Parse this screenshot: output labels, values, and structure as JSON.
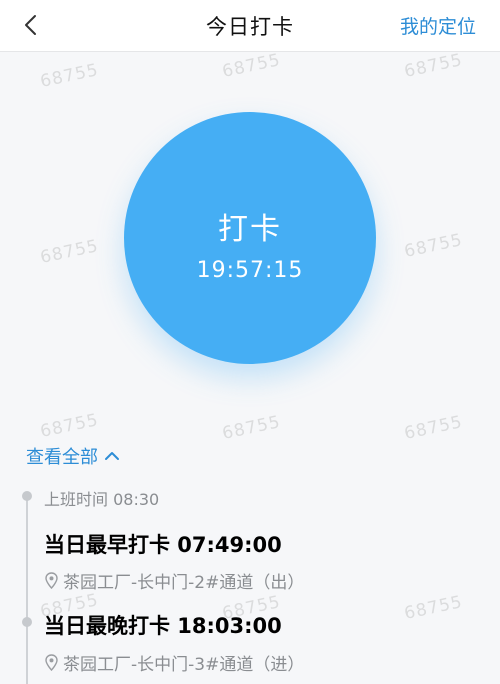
{
  "header": {
    "title": "今日打卡",
    "action_label": "我的定位"
  },
  "watermark_text": "68755",
  "clock": {
    "label": "打卡",
    "time": "19:57:15"
  },
  "view_all": {
    "label": "查看全部"
  },
  "timeline": {
    "shift_label": "上班时间 08:30",
    "records": [
      {
        "title": "当日最早打卡 07:49:00",
        "location": "茶园工厂-长中门-2#通道（出）"
      },
      {
        "title": "当日最晚打卡 18:03:00",
        "location": "茶园工厂-长中门-3#通道（进）"
      }
    ]
  },
  "colors": {
    "accent": "#2d8dd6",
    "clock_circle": "#45aef4",
    "muted_text": "#8a8d91"
  }
}
